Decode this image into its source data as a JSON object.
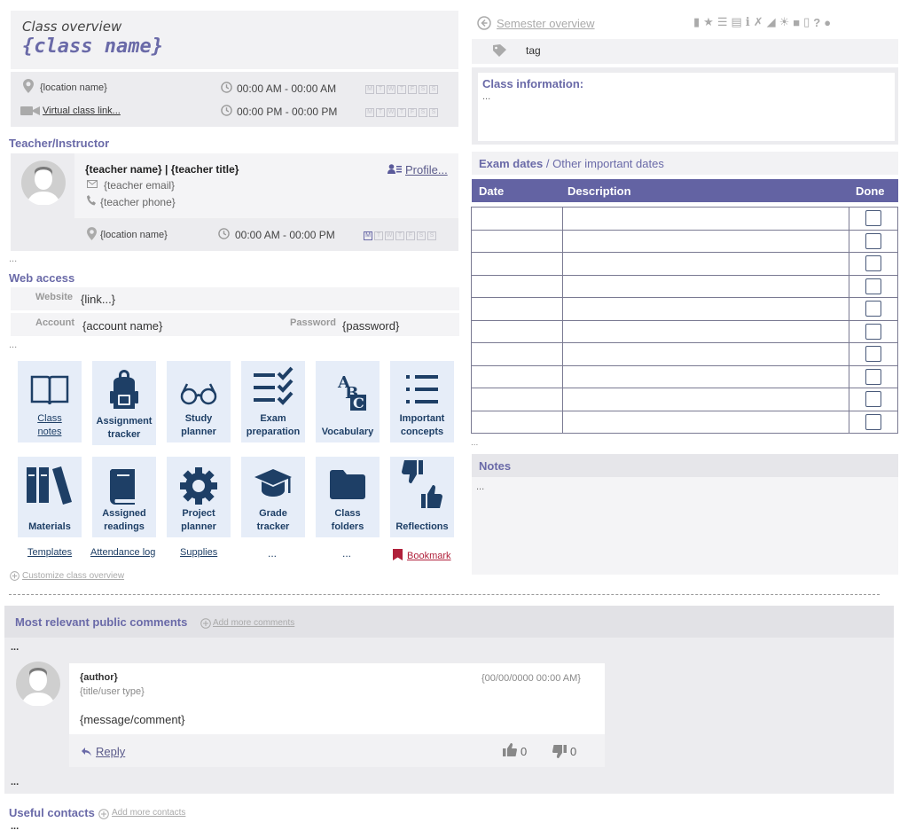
{
  "header": {
    "subtitle": "Class overview",
    "class_name": "{class name}"
  },
  "location": {
    "location_name": "{location name}",
    "virtual_link": "Virtual class link...",
    "time1": "00:00 AM - 00:00 AM",
    "time2": "00:00 PM - 00:00 PM",
    "days": [
      "M",
      "T",
      "W",
      "T",
      "F",
      "S",
      "S"
    ]
  },
  "teacher": {
    "section_title": "Teacher/Instructor",
    "name_title": "{teacher name} | {teacher title}",
    "email": "{teacher email}",
    "phone": "{teacher phone}",
    "profile_link": "Profile...",
    "location": "{location name}",
    "time": "00:00 AM - 00:00 PM",
    "active_day_index": 0
  },
  "ellipsis": "...",
  "web_access": {
    "section_title": "Web access",
    "website_label": "Website",
    "website_value": "{link...}",
    "account_label": "Account",
    "account_value": "{account name}",
    "password_label": "Password",
    "password_value": "{password}"
  },
  "tiles_row1": [
    {
      "label1": "Class",
      "label2": "notes",
      "icon": "book-icon"
    },
    {
      "label1": "Assignment",
      "label2": "tracker",
      "icon": "backpack-icon"
    },
    {
      "label1": "Study",
      "label2": "planner",
      "icon": "glasses-icon"
    },
    {
      "label1": "Exam",
      "label2": "preparation",
      "icon": "checklist-icon"
    },
    {
      "label1": "",
      "label2": "Vocabulary",
      "icon": "abc-icon"
    },
    {
      "label1": "Important",
      "label2": "concepts",
      "icon": "list-icon"
    }
  ],
  "tiles_row2": [
    {
      "label1": "",
      "label2": "Materials",
      "icon": "binders-icon"
    },
    {
      "label1": "Assigned",
      "label2": "readings",
      "icon": "reading-book-icon"
    },
    {
      "label1": "Project",
      "label2": "planner",
      "icon": "gear-icon"
    },
    {
      "label1": "Grade",
      "label2": "tracker",
      "icon": "graduation-cap-icon"
    },
    {
      "label1": "Class",
      "label2": "folders",
      "icon": "folder-icon"
    },
    {
      "label1": "",
      "label2": "Reflections",
      "icon": "thumbs-icon"
    }
  ],
  "extra_links": [
    "Templates",
    "Attendance log",
    "Supplies",
    "...",
    "...",
    "Bookmark"
  ],
  "customize": "Customize class overview",
  "right": {
    "semester": "Semester overview",
    "tag": "tag",
    "class_info_title": "Class information:",
    "class_info_body": "...",
    "exam_title": "Exam dates",
    "exam_sep": " / ",
    "exam_other": "Other important dates",
    "table_headers": {
      "date": "Date",
      "description": "Description",
      "done": "Done"
    },
    "rows": 10,
    "notes_title": "Notes",
    "notes_body": "..."
  },
  "comments": {
    "title": "Most relevant public comments",
    "add_more": "Add more comments",
    "author": "{author}",
    "user_type": "{title/user type}",
    "date": "{00/00/0000 00:00 AM}",
    "message": "{message/comment}",
    "reply": "Reply",
    "likes": "0",
    "dislikes": "0"
  },
  "contacts": {
    "title": "Useful contacts",
    "add_more": "Add more contacts"
  },
  "colors": {
    "accent": "#6a6aa8",
    "tile_bg": "#e6edf8",
    "icon_navy": "#1e3f66",
    "bookmark_red": "#b0203a"
  }
}
